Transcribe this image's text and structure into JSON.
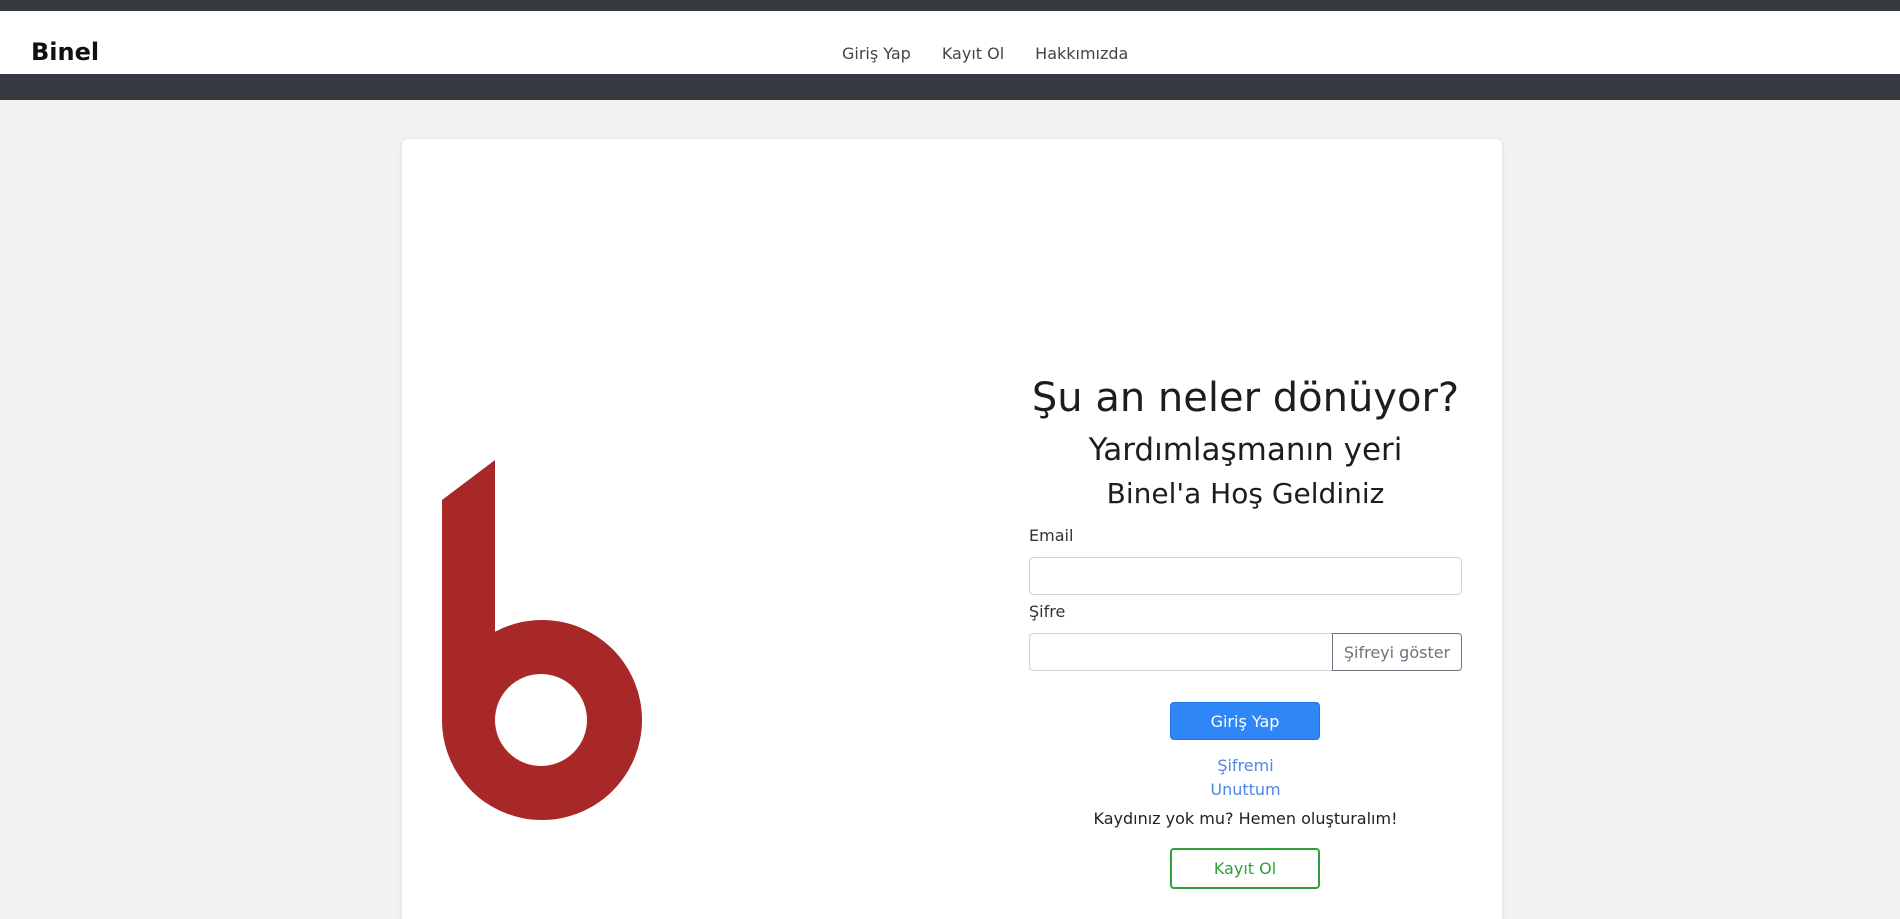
{
  "navbar": {
    "brand": "Binel",
    "links": [
      "Giriş Yap",
      "Kayıt Ol",
      "Hakkımızda"
    ]
  },
  "logo": {
    "icon": "binel-b-logo",
    "color": "#a82828"
  },
  "hero": {
    "title": "Şu an neler dönüyor?",
    "subtitle": "Yardımlaşmanın yeri",
    "welcome": "Binel'a Hoş Geldiniz"
  },
  "form": {
    "email_label": "Email",
    "email_value": "",
    "password_label": "Şifre",
    "password_value": "",
    "show_password_label": "Şifreyi göster",
    "login_label": "Giriş Yap",
    "forgot_line1": "Şifremi",
    "forgot_line2": "Unuttum",
    "no_account_text": "Kaydınız yok mu? Hemen oluşturalım!",
    "register_label": "Kayıt Ol"
  },
  "colors": {
    "header_dark": "#343a40",
    "primary": "#2f86f6",
    "success": "#2fa13a",
    "link": "#4a87e8",
    "brand_red": "#a82828"
  }
}
